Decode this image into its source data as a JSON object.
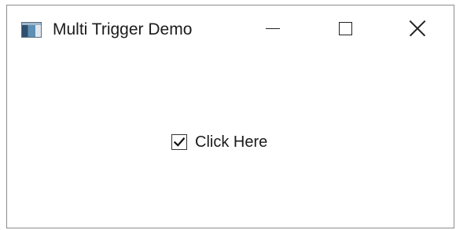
{
  "window": {
    "title": "Multi Trigger Demo",
    "icon": "window-app-icon",
    "controls": {
      "minimize": "minimize-icon",
      "maximize": "maximize-icon",
      "close": "close-icon"
    }
  },
  "content": {
    "checkbox": {
      "label": "Click Here",
      "checked": true,
      "icon": "checkmark-icon"
    }
  }
}
